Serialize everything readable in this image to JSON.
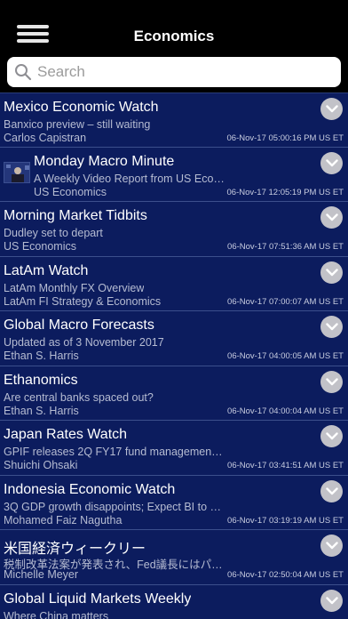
{
  "nav": {
    "title": "Economics",
    "menu_icon": "hamburger-menu-icon"
  },
  "search": {
    "placeholder": "Search"
  },
  "items": [
    {
      "title": "Mexico Economic Watch",
      "subtitle": "Banxico preview – still waiting",
      "author": "Carlos Capistran",
      "date": "06-Nov-17 05:00:16 PM US ET",
      "thumb": false
    },
    {
      "title": "Monday Macro Minute",
      "subtitle": "A Weekly Video Report from US Eco…",
      "author": "US Economics",
      "date": "06-Nov-17 12:05:19 PM US ET",
      "thumb": true
    },
    {
      "title": "Morning Market Tidbits",
      "subtitle": "Dudley set to depart",
      "author": "US Economics",
      "date": "06-Nov-17 07:51:36 AM US ET",
      "thumb": false
    },
    {
      "title": "LatAm Watch",
      "subtitle": "LatAm Monthly FX Overview",
      "author": "LatAm FI Strategy & Economics",
      "date": "06-Nov-17 07:00:07 AM US ET",
      "thumb": false
    },
    {
      "title": "Global Macro Forecasts",
      "subtitle": "Updated as of 3 November 2017",
      "author": "Ethan S. Harris",
      "date": "06-Nov-17 04:00:05 AM US ET",
      "thumb": false
    },
    {
      "title": "Ethanomics",
      "subtitle": "Are central banks spaced out?",
      "author": "Ethan S. Harris",
      "date": "06-Nov-17 04:00:04 AM US ET",
      "thumb": false
    },
    {
      "title": "Japan Rates Watch",
      "subtitle": "GPIF releases 2Q FY17 fund management…",
      "author": "Shuichi Ohsaki",
      "date": "06-Nov-17 03:41:51 AM US ET",
      "thumb": false
    },
    {
      "title": "Indonesia Economic Watch",
      "subtitle": "3Q GDP growth disappoints; Expect BI to e…",
      "author": "Mohamed Faiz Nagutha",
      "date": "06-Nov-17 03:19:19 AM US ET",
      "thumb": false
    },
    {
      "title": "米国経済ウィークリー",
      "subtitle": "税制改革法案が発表され、Fed議長にはパ…",
      "author": "Michelle Meyer",
      "date": "06-Nov-17 02:50:04 AM US ET",
      "thumb": false
    },
    {
      "title": "Global Liquid Markets Weekly",
      "subtitle": "Where China matters",
      "author": "",
      "date": "",
      "thumb": false
    }
  ],
  "colors": {
    "navbar": "#000000",
    "list_bg": "#0c1c5e",
    "separator": "#3c4f8c",
    "chevron_bg": "#c2c2c8"
  },
  "icons": {
    "search": "search-icon",
    "expand": "chevron-down-icon",
    "thumbnail": "video-thumbnail-icon"
  }
}
